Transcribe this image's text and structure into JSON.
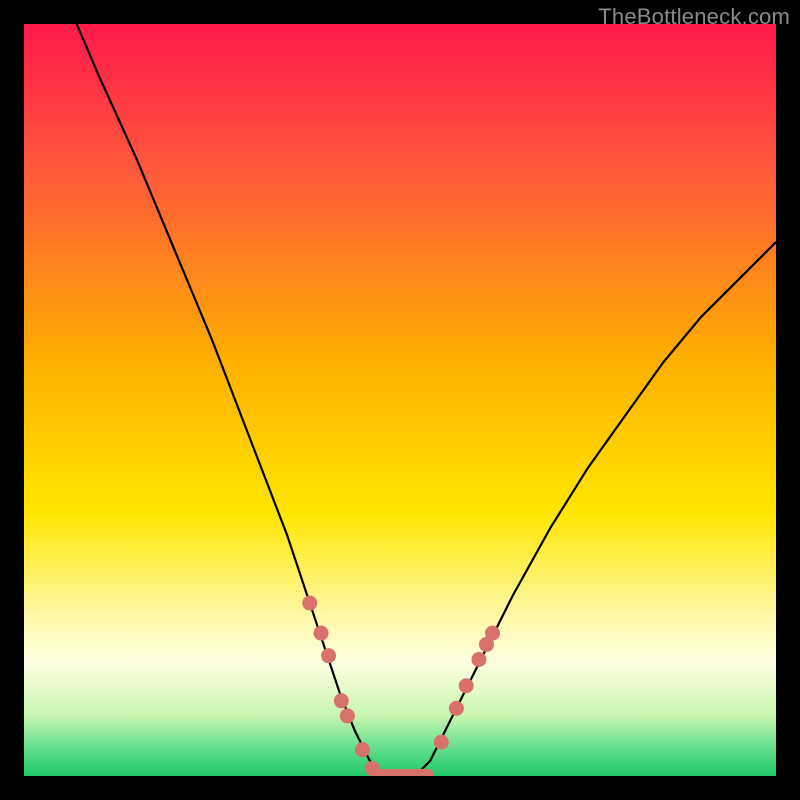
{
  "watermark": "TheBottleneck.com",
  "chart_data": {
    "type": "line",
    "title": "",
    "xlabel": "",
    "ylabel": "",
    "xlim": [
      0,
      100
    ],
    "ylim": [
      0,
      100
    ],
    "grid": false,
    "series": [
      {
        "name": "bottleneck-curve",
        "x": [
          7,
          10,
          15,
          20,
          25,
          30,
          35,
          38,
          40,
          42,
          44,
          46,
          48,
          50,
          52,
          54,
          56,
          60,
          65,
          70,
          75,
          80,
          85,
          90,
          95,
          100
        ],
        "y": [
          100,
          93,
          82,
          70,
          58,
          45,
          32,
          23,
          17,
          11,
          6,
          2,
          0,
          0,
          0,
          2,
          6,
          14,
          24,
          33,
          41,
          48,
          55,
          61,
          66,
          71
        ]
      }
    ],
    "markers": {
      "name": "highlight-dots",
      "color": "#d9716b",
      "points": [
        {
          "x": 38.0,
          "y": 23.0
        },
        {
          "x": 39.5,
          "y": 19.0
        },
        {
          "x": 40.5,
          "y": 16.0
        },
        {
          "x": 42.2,
          "y": 10.0
        },
        {
          "x": 43.0,
          "y": 8.0
        },
        {
          "x": 45.0,
          "y": 3.5
        },
        {
          "x": 46.3,
          "y": 1.0
        },
        {
          "x": 55.5,
          "y": 4.5
        },
        {
          "x": 57.5,
          "y": 9.0
        },
        {
          "x": 58.8,
          "y": 12.0
        },
        {
          "x": 60.5,
          "y": 15.5
        },
        {
          "x": 61.5,
          "y": 17.5
        },
        {
          "x": 62.3,
          "y": 19.0
        }
      ]
    },
    "flat_segment": {
      "name": "trough-bar",
      "color": "#d9716b",
      "x_start": 46.5,
      "x_end": 54.5,
      "y": 0
    },
    "gradient_stops": [
      {
        "offset": 0.0,
        "color": "#ff1a4b"
      },
      {
        "offset": 0.2,
        "color": "#ff5a3a"
      },
      {
        "offset": 0.45,
        "color": "#ffb000"
      },
      {
        "offset": 0.65,
        "color": "#ffe600"
      },
      {
        "offset": 0.78,
        "color": "#fff7a0"
      },
      {
        "offset": 0.85,
        "color": "#ffffe0"
      },
      {
        "offset": 0.92,
        "color": "#c8f5b0"
      },
      {
        "offset": 0.96,
        "color": "#68e090"
      },
      {
        "offset": 1.0,
        "color": "#20c868"
      }
    ]
  }
}
